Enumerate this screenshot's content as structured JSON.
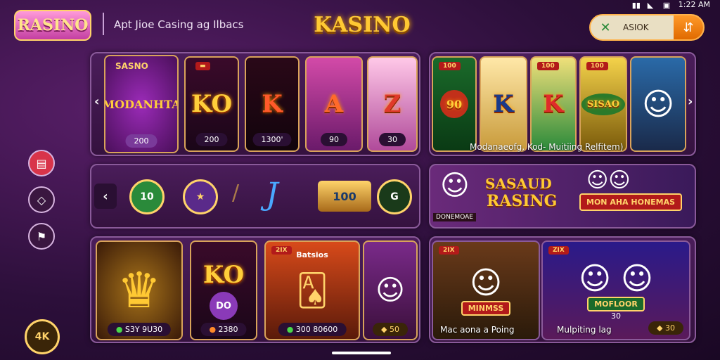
{
  "status": {
    "time": "1:22 AM"
  },
  "header": {
    "logo_small": "RASINO",
    "subtitle": "Apt Jioe Casing ag Ilbacs",
    "logo_main": "KASINO",
    "search_label": "ASIOK",
    "search_btn": "⇵"
  },
  "row1": {
    "featured": {
      "tag": "SASNO",
      "title": "MODANHTA",
      "price": "200"
    },
    "tiles": [
      {
        "tag": "",
        "big": "KO",
        "price": "200"
      },
      {
        "tag": "",
        "big": "K",
        "price": "1300'"
      },
      {
        "tag": "",
        "big": "A",
        "price": "90"
      },
      {
        "tag": "",
        "big": "Z",
        "price": "30"
      }
    ]
  },
  "row1b": {
    "tiles": [
      {
        "tag": "100",
        "big": "90"
      },
      {
        "tag": "",
        "big": "K"
      },
      {
        "tag": "100",
        "big": "K"
      },
      {
        "tag": "100",
        "big": "SISAO"
      },
      {
        "tag": "",
        "big": ""
      }
    ],
    "caption": "Modanaeofg, Kod-  Muitiing Relfitem)"
  },
  "row2": {
    "chips": [
      "10",
      "★",
      "J",
      "100",
      "G"
    ],
    "promo": {
      "title1": "SASAUD",
      "title2": "RASING",
      "banner": "MON AHA HONEMAS",
      "sublabel": "DONEMOAE"
    }
  },
  "row3": {
    "tiles": [
      {
        "big": "",
        "price": "S3Y 9U30",
        "tag": ""
      },
      {
        "big": "KO",
        "price": "2380",
        "tag": "",
        "sub": "DO"
      },
      {
        "big": "",
        "price": "300 80600",
        "tag": "2IX",
        "sub": "Batsios"
      },
      {
        "big": "",
        "price": "50",
        "tag": ""
      }
    ],
    "right": {
      "tags": [
        "2IX",
        "ZIX"
      ],
      "banner1": "MINMSS",
      "banner2": "MOFLOOR",
      "value": "30",
      "caption1": "Mac aona a Poing",
      "caption2": "Mulpiting lag",
      "price": "30"
    }
  },
  "side": {
    "chip": "4K"
  },
  "colors": {
    "accent": "#ffc933",
    "bg": "#2c0f3a",
    "panel": "#4a1d5a",
    "side_red": "#d8344a"
  }
}
